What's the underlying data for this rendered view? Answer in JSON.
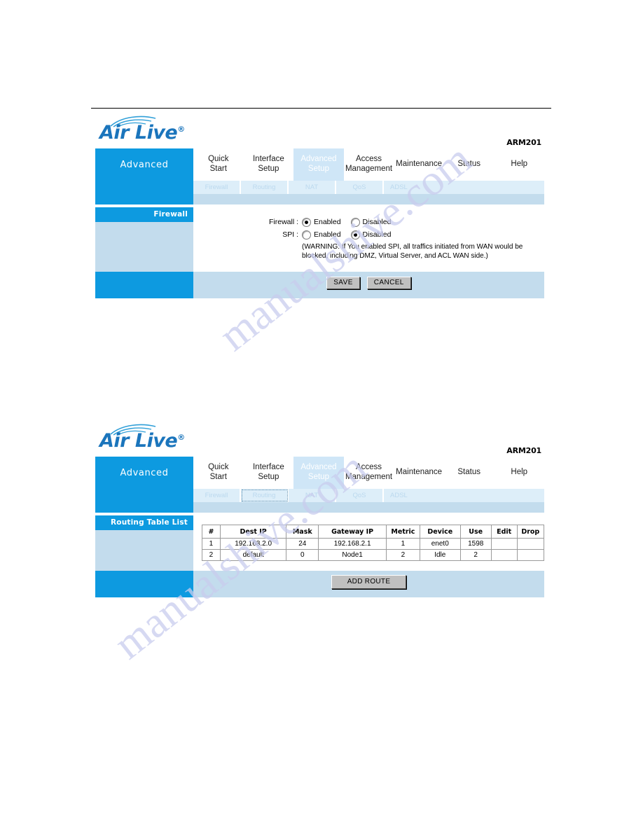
{
  "brand": {
    "logo_text": "Air Live",
    "logo_registered": "®",
    "model": "ARM201"
  },
  "nav": {
    "brand_label": "Advanced",
    "tabs": [
      {
        "line1": "Quick",
        "line2": "Start",
        "active": false
      },
      {
        "line1": "Interface",
        "line2": "Setup",
        "active": false
      },
      {
        "line1": "Advanced",
        "line2": "Setup",
        "active": true
      },
      {
        "line1": "Access",
        "line2": "Management",
        "active": false
      },
      {
        "line1": "Maintenance",
        "line2": "",
        "active": false
      },
      {
        "line1": "Status",
        "line2": "",
        "active": false
      },
      {
        "line1": "Help",
        "line2": "",
        "active": false
      }
    ],
    "subtabs": [
      "Firewall",
      "Routing",
      "NAT",
      "QoS",
      "ADSL"
    ]
  },
  "firewall_panel": {
    "section_title": "Firewall",
    "firewall_label": "Firewall :",
    "spi_label": "SPI :",
    "option_enabled": "Enabled",
    "option_disabled": "Disabled",
    "firewall_value": "Enabled",
    "spi_value": "Disabled",
    "warning": "(WARNING: If You enabled SPI, all traffics initiated from WAN would be blocked, including DMZ, Virtual Server, and ACL WAN side.)",
    "save_label": "SAVE",
    "cancel_label": "CANCEL"
  },
  "routing_panel": {
    "section_title": "Routing Table List",
    "columns": [
      "#",
      "Dest IP",
      "Mask",
      "Gateway IP",
      "Metric",
      "Device",
      "Use",
      "Edit",
      "Drop"
    ],
    "rows": [
      {
        "num": "1",
        "dest_ip": "192.168.2.0",
        "mask": "24",
        "gateway_ip": "192.168.2.1",
        "metric": "1",
        "device": "enet0",
        "use": "1598",
        "edit": "",
        "drop": ""
      },
      {
        "num": "2",
        "dest_ip": "default",
        "mask": "0",
        "gateway_ip": "Node1",
        "metric": "2",
        "device": "Idle",
        "use": "2",
        "edit": "",
        "drop": ""
      }
    ],
    "add_route_label": "ADD ROUTE"
  },
  "watermark": {
    "line1": "manualshive.com",
    "line2": "manualshive.com"
  },
  "colors": {
    "brand_blue": "#0d9ae0",
    "panel_light_blue": "#c3dced",
    "subtab_bg": "#ddeef9",
    "logo_blue": "#1b75bc"
  }
}
